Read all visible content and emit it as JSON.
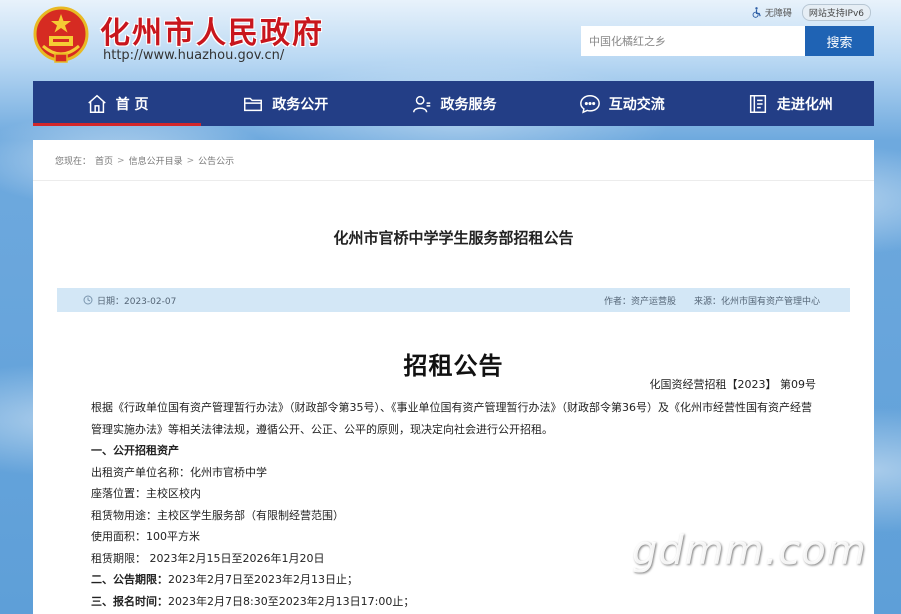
{
  "header": {
    "site_title": "化州市人民政府",
    "site_url": "http://www.huazhou.gov.cn/",
    "accessibility_label": "无障碍",
    "ipv6_label": "网站支持IPv6",
    "search_placeholder": "中国化橘红之乡",
    "search_button": "搜索"
  },
  "nav": {
    "items": [
      {
        "label": "首 页",
        "icon": "home-icon",
        "active": true
      },
      {
        "label": "政务公开",
        "icon": "folder-icon",
        "active": false
      },
      {
        "label": "政务服务",
        "icon": "user-service-icon",
        "active": false
      },
      {
        "label": "互动交流",
        "icon": "chat-icon",
        "active": false
      },
      {
        "label": "走进化州",
        "icon": "book-icon",
        "active": false
      }
    ]
  },
  "breadcrumb": {
    "prefix": "您现在：",
    "items": [
      "首页",
      "信息公开目录",
      "公告公示"
    ],
    "separator": ">"
  },
  "article": {
    "title": "化州市官桥中学学生服务部招租公告",
    "date_label": "日期：2023-02-07",
    "author_label": "作者：资产运营股",
    "source_label": "来源：化州市国有资产管理中心",
    "notice_heading": "招租公告",
    "doc_number": "化国资经营招租【2023】 第09号",
    "paragraphs": [
      {
        "text": "根据《行政单位国有资产管理暂行办法》（财政部令第35号）、《事业单位国有资产管理暂行办法》（财政部令第36号）及《化州市经营性国有资产经营管理实施办法》等相关法律法规，遵循公开、公正、公平的原则，现决定向社会进行公开招租。",
        "bold": false
      },
      {
        "text": "一、公开招租资产",
        "bold": true
      },
      {
        "text": "出租资产单位名称：化州市官桥中学",
        "bold": false
      },
      {
        "text": "座落位置：主校区校内",
        "bold": false
      },
      {
        "text": "租赁物用途：主校区学生服务部（有限制经营范围）",
        "bold": false
      },
      {
        "text": "使用面积：100平方米",
        "bold": false
      },
      {
        "text": "租赁期限： 2023年2月15日至2026年1月20日",
        "bold": false
      }
    ],
    "period_label": "二、公告期限：",
    "period_value": "2023年2月7日至2023年2月13日止；",
    "signup_label": "三、报名时间：",
    "signup_value": "2023年2月7日8:30至2023年2月13日17:00止；"
  },
  "watermark": "gdmm.com",
  "colors": {
    "brand_red": "#c8161d",
    "nav_blue": "#233e86",
    "search_blue": "#1f63b4",
    "meta_bg": "#d3e7f6"
  }
}
